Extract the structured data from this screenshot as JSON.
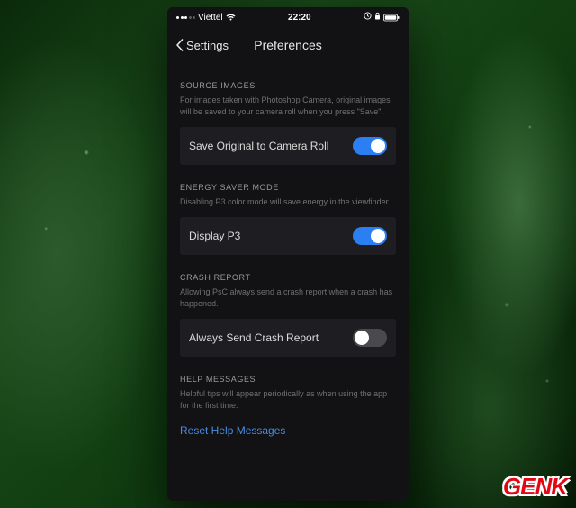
{
  "statusbar": {
    "carrier": "Viettel",
    "time": "22:20",
    "signal_bars": 3,
    "lock_icon": "lock-icon",
    "orientation_icon": "orientation-lock-icon",
    "battery_icon": "battery-icon"
  },
  "navbar": {
    "back_label": "Settings",
    "title": "Preferences"
  },
  "sections": {
    "source_images": {
      "header": "SOURCE IMAGES",
      "desc": "For images taken with Photoshop Camera, original images will be saved to your camera roll when you press \"Save\".",
      "row_label": "Save Original to Camera Roll",
      "toggle_on": true
    },
    "energy_saver": {
      "header": "ENERGY SAVER MODE",
      "desc": "Disabling P3 color mode will save energy in the viewfinder.",
      "row_label": "Display P3",
      "toggle_on": true
    },
    "crash_report": {
      "header": "CRASH REPORT",
      "desc": "Allowing PsC always send a crash report when a crash has happened.",
      "row_label": "Always Send Crash Report",
      "toggle_on": false
    },
    "help_messages": {
      "header": "HELP MESSAGES",
      "desc": "Helpful tips will appear periodically as when using the app for the first time.",
      "link_label": "Reset Help Messages"
    }
  },
  "watermark": "GENK",
  "colors": {
    "accent_toggle": "#2b7ff2",
    "link": "#4a8be0",
    "watermark_red": "#e30613"
  }
}
